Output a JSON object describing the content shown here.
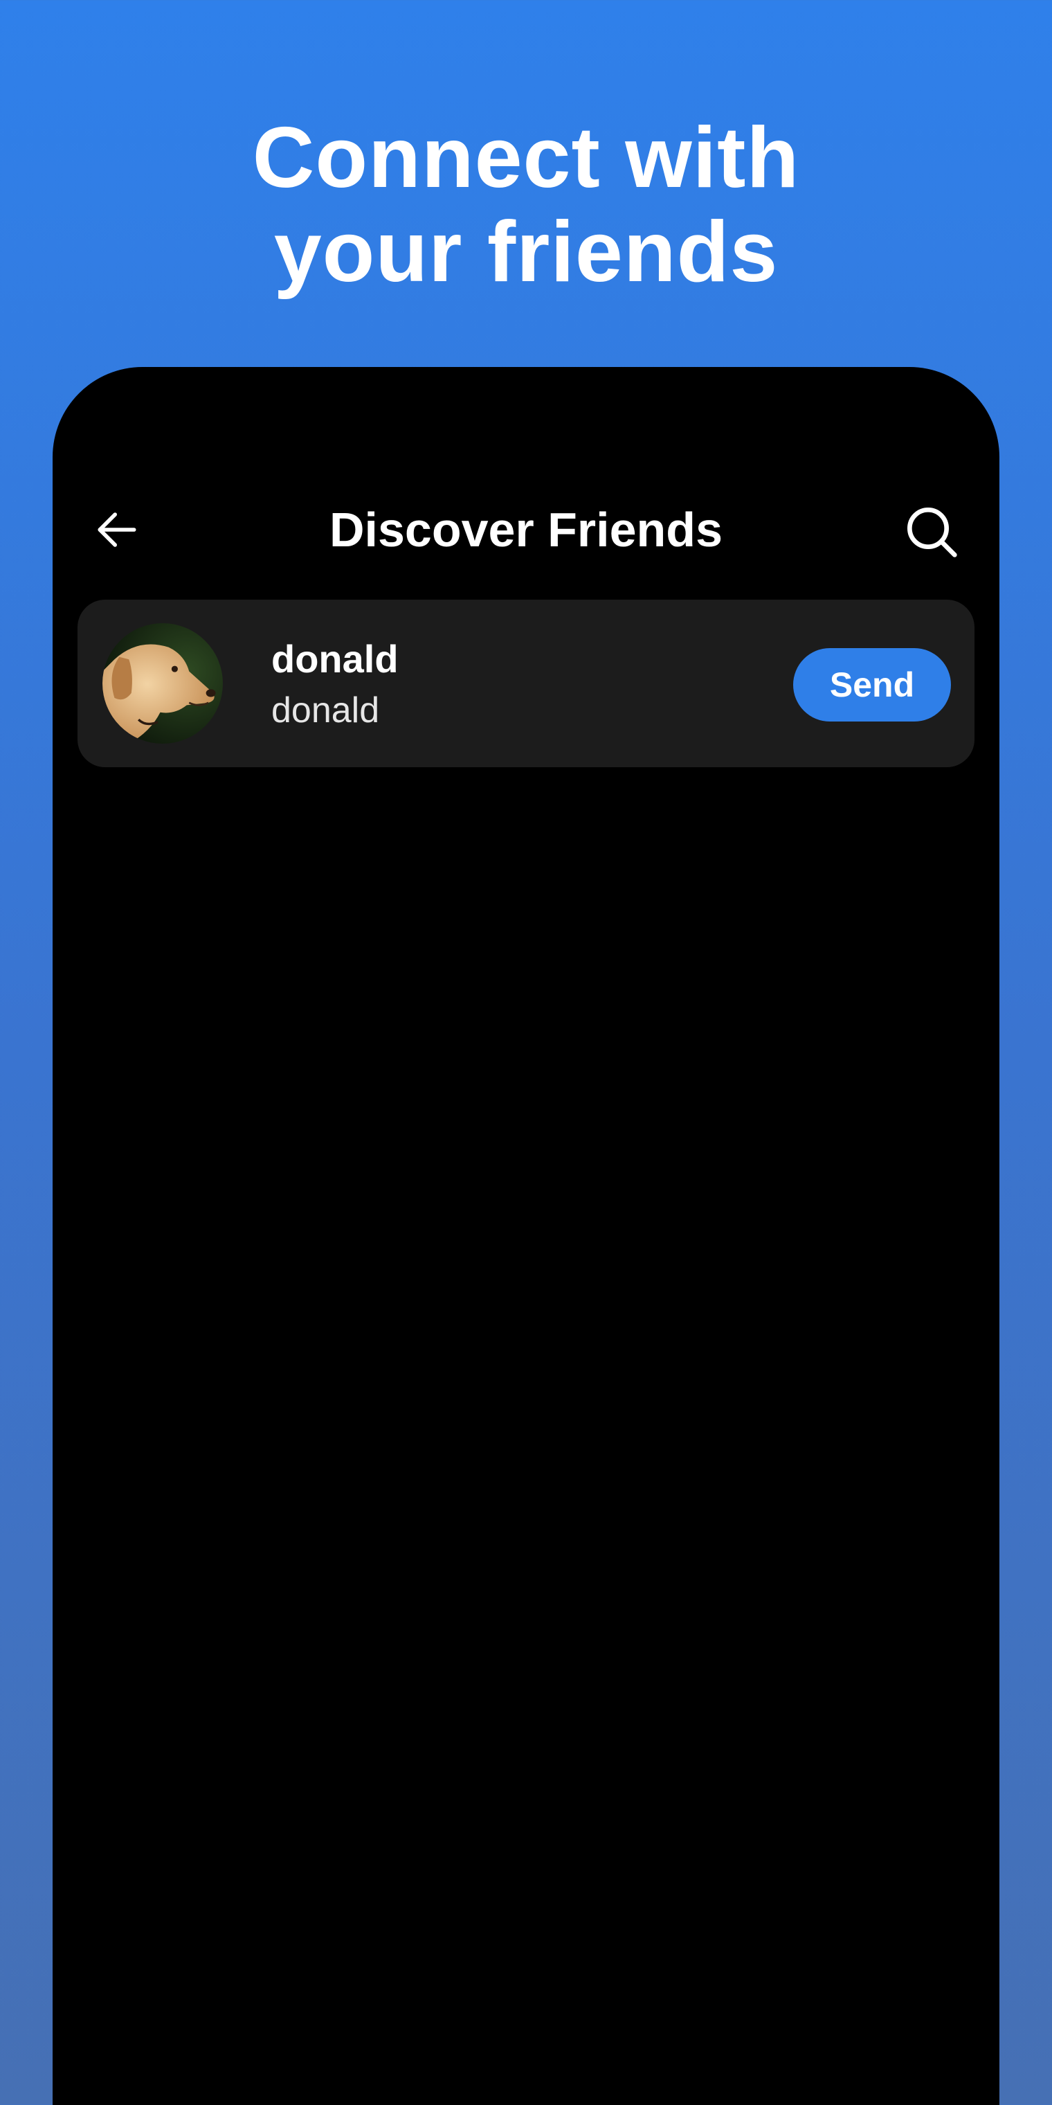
{
  "headline": {
    "line1": "Connect with",
    "line2": "your friends"
  },
  "screen": {
    "title": "Discover Friends",
    "back_icon": "arrow-left-icon",
    "search_icon": "search-icon"
  },
  "friends": [
    {
      "name": "donald",
      "username": "donald",
      "avatar": "dog-avatar",
      "action_label": "Send"
    }
  ],
  "colors": {
    "background_top": "#2f80ea",
    "background_bottom": "#4670b4",
    "phone_background": "#000000",
    "card_background": "#1c1c1c",
    "accent": "#2f7fe8",
    "text": "#ffffff"
  }
}
